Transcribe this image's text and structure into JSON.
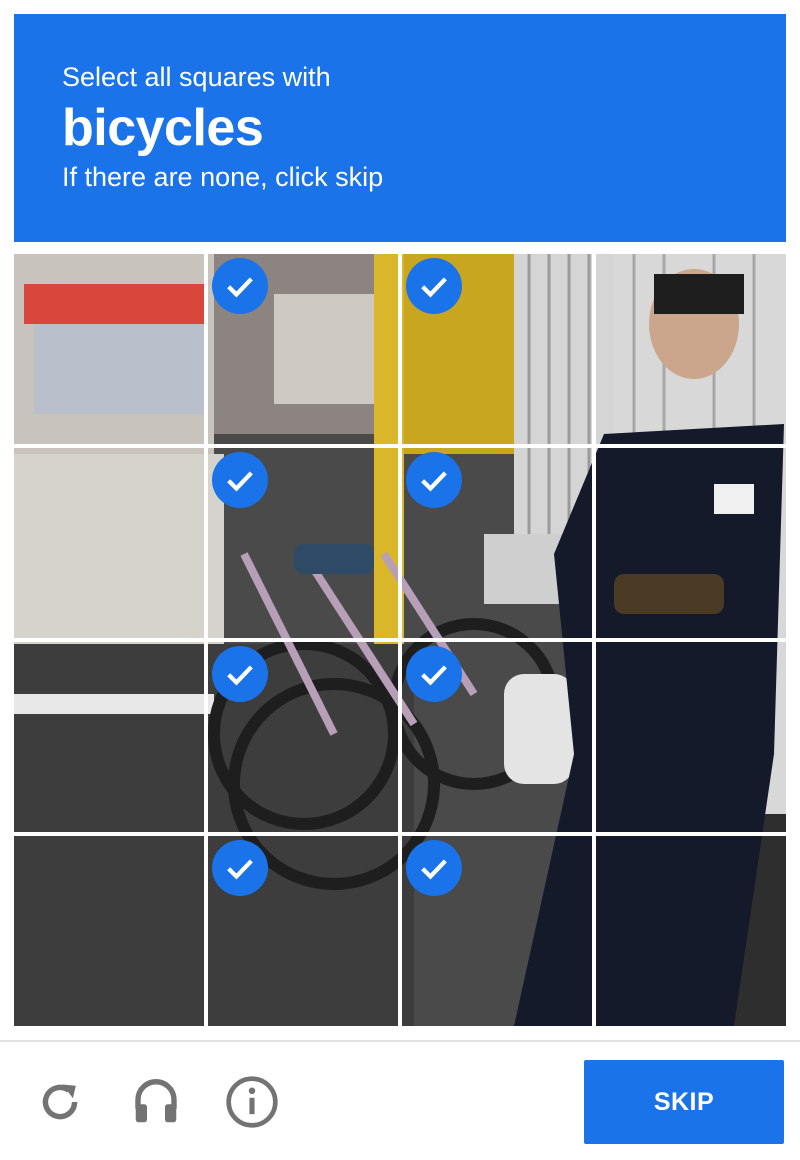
{
  "header": {
    "line1": "Select all squares with",
    "keyword": "bicycles",
    "line3": "If there are none, click skip",
    "background_color": "#1a73e8"
  },
  "grid": {
    "rows": 4,
    "cols": 4,
    "selected": [
      [
        false,
        true,
        true,
        false
      ],
      [
        false,
        true,
        true,
        false
      ],
      [
        false,
        true,
        true,
        false
      ],
      [
        false,
        true,
        true,
        false
      ]
    ],
    "check_color": "#1a73e8"
  },
  "footer": {
    "icons": [
      "reload-icon",
      "headphones-icon",
      "info-icon"
    ],
    "skip_label": "SKIP"
  }
}
